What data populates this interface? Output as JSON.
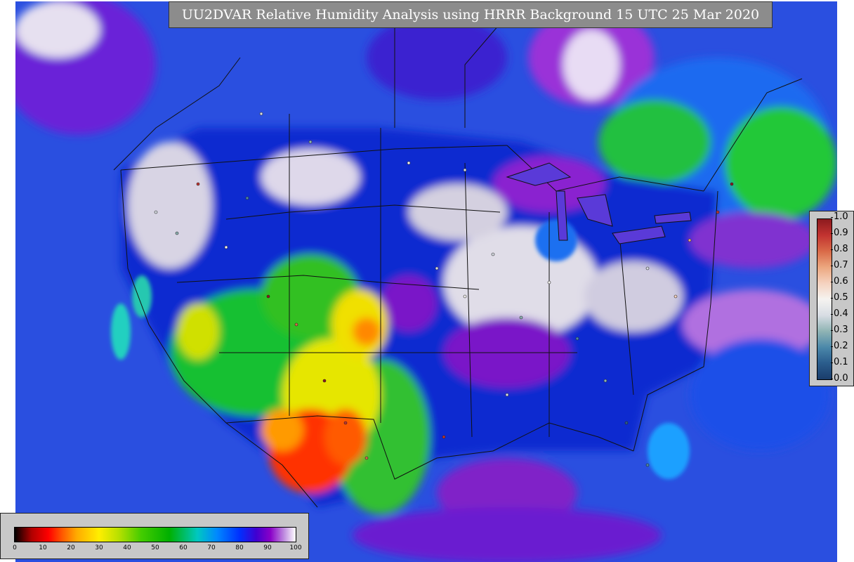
{
  "title": "UU2DVAR Relative Humidity Analysis using HRRR Background 15 UTC 25 Mar 2020",
  "legends": {
    "station_colorbar": {
      "ticks": [
        "1.0",
        "0.9",
        "0.8",
        "0.7",
        "0.6",
        "0.5",
        "0.4",
        "0.3",
        "0.2",
        "0.1",
        "0.0"
      ],
      "colors": [
        "#8c1a1e",
        "#c23330",
        "#d96a48",
        "#eca77f",
        "#f5d2bf",
        "#f5f3f0",
        "#d8dde4",
        "#8fb4b4",
        "#4b88aa",
        "#2a5c8c",
        "#1a3d6b"
      ]
    },
    "analysis_colorbar": {
      "ticks": [
        "0",
        "10",
        "20",
        "30",
        "40",
        "50",
        "60",
        "70",
        "80",
        "90",
        "100"
      ],
      "colors": [
        "#000000",
        "#b00000",
        "#ff5a00",
        "#ffee00",
        "#44cc00",
        "#00b000",
        "#00c8c0",
        "#0030ff",
        "#8a00c8",
        "#ffffff"
      ]
    }
  },
  "map": {
    "colors": {
      "ocean": "#2a4fe0",
      "humid": "#0a2ad0",
      "saturated": "#e0dde8",
      "purple": "#7a18c8",
      "green": "#12c030",
      "yellow": "#f0f000",
      "red": "#ff1a00",
      "borders": "#111111"
    }
  }
}
